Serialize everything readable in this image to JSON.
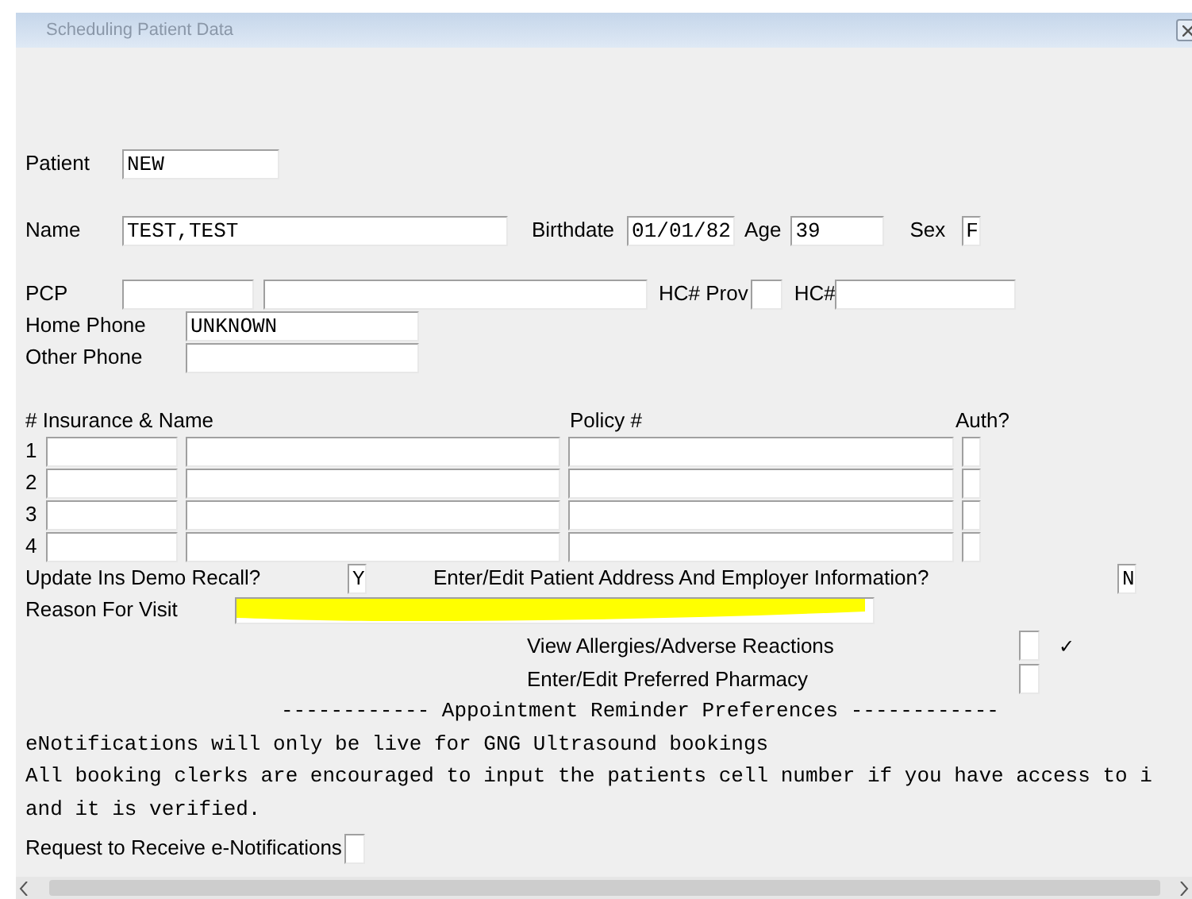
{
  "window": {
    "title": "Scheduling Patient Data"
  },
  "patient": {
    "label": "Patient",
    "value": "NEW"
  },
  "name": {
    "label": "Name",
    "value": "TEST,TEST"
  },
  "birthdate": {
    "label": "Birthdate",
    "value": "01/01/82"
  },
  "age": {
    "label": "Age",
    "value": "39"
  },
  "sex": {
    "label": "Sex",
    "value": "F"
  },
  "pcp": {
    "label": "PCP"
  },
  "hc_prov": {
    "label": "HC# Prov"
  },
  "hc_number": {
    "label": "HC#"
  },
  "home_phone": {
    "label": "Home Phone",
    "value": "UNKNOWN"
  },
  "other_phone": {
    "label": "Other Phone"
  },
  "insurance": {
    "columns": [
      "# Insurance & Name",
      "Policy #",
      "Auth?"
    ],
    "rows": [
      {
        "number": "1"
      },
      {
        "number": "2"
      },
      {
        "number": "3"
      },
      {
        "number": "4"
      }
    ]
  },
  "update_ins_demo_recall": {
    "label": "Update Ins Demo Recall?",
    "value": "Y"
  },
  "enter_edit_address": {
    "label": "Enter/Edit Patient Address And Employer Information?",
    "value": "N"
  },
  "reason_for_visit": {
    "label": "Reason For Visit",
    "highlighted": true
  },
  "options": [
    {
      "label": "View Allergies/Adverse Reactions",
      "checked": false,
      "note": "✓"
    },
    {
      "label": "Enter/Edit Preferred Pharmacy",
      "checked": false
    }
  ],
  "reminder_heading": "------------ Appointment Reminder Preferences ------------",
  "notices": [
    "eNotifications will only be live for GNG Ultrasound bookings",
    "All booking clerks are encouraged to input the patients cell number if you have access to i",
    "and it is verified."
  ],
  "request_notifications": {
    "label": "Request to Receive e-Notifications",
    "checked": false
  }
}
